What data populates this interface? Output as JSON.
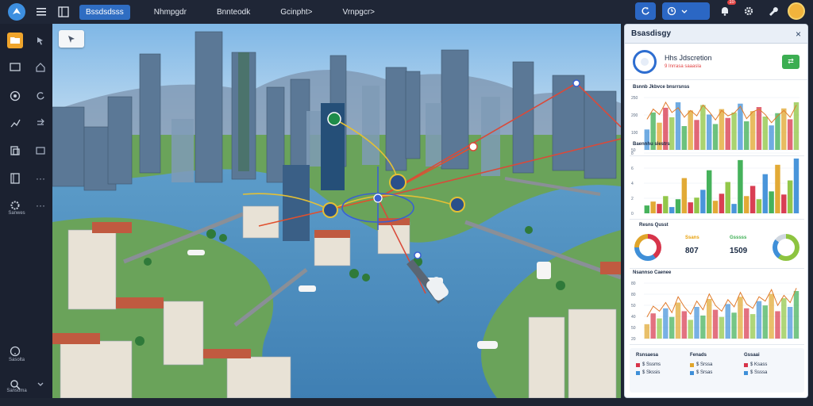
{
  "topbar": {
    "menu": [
      {
        "label": "Bssdsdsss",
        "active": true
      },
      {
        "label": "Nhmpgdr",
        "active": false
      },
      {
        "label": "Bnnteodk",
        "active": false
      },
      {
        "label": "Gcinpht>",
        "active": false
      },
      {
        "label": "Vrnpgcr>",
        "active": false
      }
    ],
    "notification_count": "10"
  },
  "sidebar": {
    "labels": [
      "Sanwes",
      "Sasolta",
      "Sansoma"
    ]
  },
  "panel": {
    "title": "Bsasdisgy",
    "close": "×",
    "summary_title": "Hhs Jdscretion",
    "summary_sub": "9 Inrrasa saaasla",
    "chart1_title": "Bsnnb Jkbvce bnsrrsnss",
    "chart2_title": "Baennhu slestrs",
    "kpi_title": "Resns Qusst",
    "kpi1_label": "Ssans",
    "kpi1_value": "807",
    "kpi2_label": "Gsssss",
    "kpi2_value": "1509",
    "chart3_title": "Nsannso Caenee",
    "table": {
      "columns": [
        {
          "header": "Rsnsaesa",
          "rows": [
            "$ Sssms",
            "$ Skssis"
          ]
        },
        {
          "header": "Fenads",
          "rows": [
            "$ Srssa",
            "$ Srsas"
          ]
        },
        {
          "header": "Gssaai",
          "rows": [
            "$ Ksass",
            "$ Ssssa"
          ]
        }
      ]
    }
  },
  "colors": {
    "accent": "#2f6dc2",
    "series": [
      "#3f8fd8",
      "#3cae52",
      "#e0a52b",
      "#d7344a",
      "#8dc440"
    ]
  },
  "chart_data": [
    {
      "type": "bar",
      "title": "Bsnnb Jkbvce bnsrrsnss",
      "ylabel_ticks": [
        "250",
        "200",
        "100",
        "50"
      ],
      "values": [
        30,
        55,
        40,
        62,
        48,
        70,
        35,
        58,
        44,
        66,
        52,
        38,
        60,
        47,
        55,
        68,
        42,
        57,
        63,
        49,
        36,
        54,
        61,
        45,
        70
      ],
      "line": [
        45,
        60,
        52,
        70,
        55,
        62,
        48,
        58,
        50,
        66,
        56,
        44,
        58,
        50,
        54,
        64,
        46,
        56,
        60,
        52,
        40,
        50,
        58,
        48,
        66
      ]
    },
    {
      "type": "bar",
      "title": "Baennhu slestrs",
      "ylabel_ticks": [
        "8",
        "6",
        "4",
        "2",
        "0"
      ],
      "values": [
        10,
        15,
        12,
        22,
        8,
        18,
        45,
        14,
        20,
        30,
        55,
        16,
        25,
        40,
        12,
        68,
        22,
        35,
        18,
        50,
        28,
        62,
        24,
        42,
        70
      ]
    },
    {
      "type": "bar",
      "title": "Nsannso Caenee",
      "ylabel_ticks": [
        "80",
        "80",
        "50",
        "40",
        "50",
        "20"
      ],
      "values": [
        20,
        35,
        28,
        42,
        30,
        50,
        38,
        26,
        44,
        32,
        55,
        40,
        30,
        48,
        36,
        58,
        42,
        34,
        52,
        46,
        62,
        38,
        56,
        44,
        66
      ],
      "line": [
        30,
        45,
        38,
        50,
        36,
        58,
        44,
        34,
        52,
        40,
        62,
        46,
        38,
        54,
        44,
        64,
        48,
        42,
        58,
        52,
        68,
        46,
        60,
        50,
        70
      ]
    }
  ]
}
